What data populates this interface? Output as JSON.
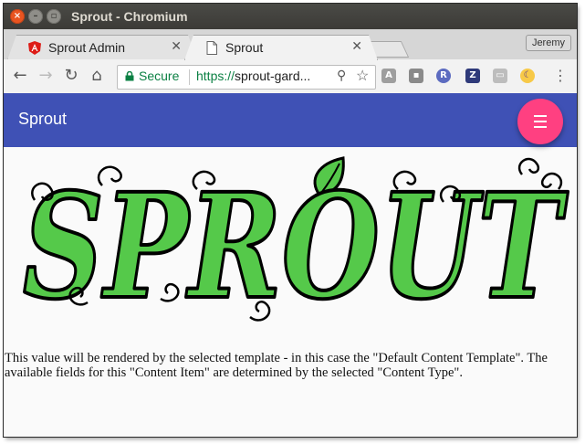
{
  "window": {
    "title": "Sprout - Chromium"
  },
  "tabs": [
    {
      "label": "Sprout Admin",
      "active": false
    },
    {
      "label": "Sprout",
      "active": true
    }
  ],
  "profile": {
    "name": "Jeremy"
  },
  "omnibox": {
    "secure_label": "Secure",
    "url_scheme": "https://",
    "url_rest": "sprout-gard..."
  },
  "app": {
    "title": "Sprout",
    "accent": "#3f51b5",
    "fab_color": "#ff4081",
    "fab_icon": "menu-icon"
  },
  "logo": {
    "text": "SPROUT"
  },
  "content": {
    "text": "This value will be rendered by the selected template - in this case the \"Default Content Template\". The available fields for this \"Content Item\" are determined by the selected \"Content Type\"."
  },
  "extensions": [
    "angular-icon",
    "note-icon",
    "r-icon",
    "z-icon",
    "cast-icon",
    "moon-icon"
  ]
}
